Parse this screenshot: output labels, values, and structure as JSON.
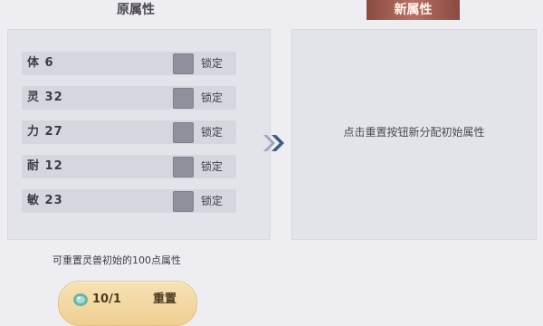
{
  "header": {
    "original_title": "原属性",
    "new_title": "新属性"
  },
  "stats": [
    {
      "label": "体 6",
      "lock_label": "锁定"
    },
    {
      "label": "灵 32",
      "lock_label": "锁定"
    },
    {
      "label": "力 27",
      "lock_label": "锁定"
    },
    {
      "label": "耐 12",
      "lock_label": "锁定"
    },
    {
      "label": "敏 23",
      "lock_label": "锁定"
    }
  ],
  "right_panel": {
    "message": "点击重置按钮新分配初始属性"
  },
  "footer": {
    "hint": "可重置灵兽初始的100点属性",
    "reset_count": "10/1",
    "reset_label": "重置"
  },
  "colors": {
    "accent": "#b87066",
    "arrow": "#3f5a86",
    "button": "#efcf92"
  }
}
